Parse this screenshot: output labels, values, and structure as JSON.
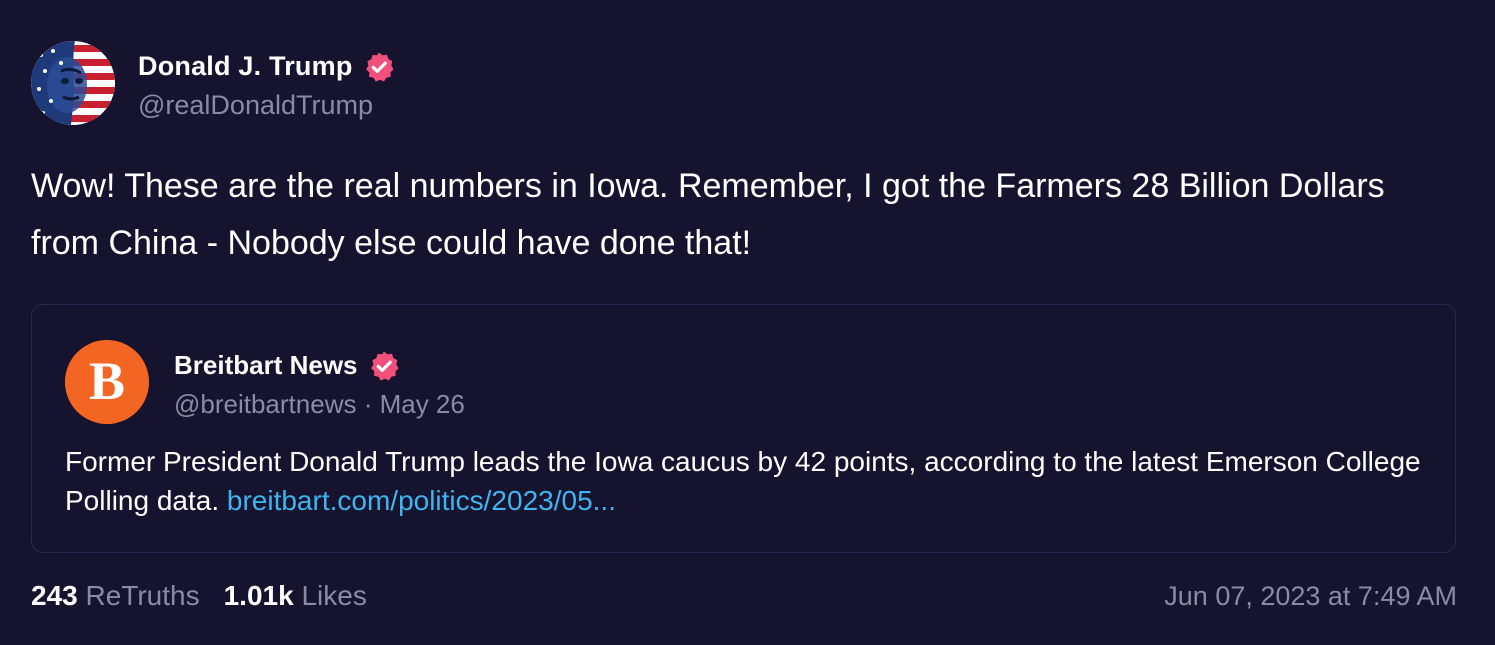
{
  "post": {
    "author": {
      "display_name": "Donald J. Trump",
      "handle": "@realDonaldTrump",
      "verified": true,
      "verified_icon": "verified-badge-icon"
    },
    "text": "Wow! These are the real numbers in Iowa. Remember, I got the Farmers 28 Billion Dollars from China - Nobody else could have done that!",
    "quote": {
      "author": {
        "display_name": "Breitbart News",
        "handle": "@breitbartnews",
        "separator": " · ",
        "date": "May 26",
        "verified": true,
        "avatar_letter": "B"
      },
      "text": "Former President Donald Trump leads the Iowa caucus by 42 points, according to the latest Emerson College Polling data. ",
      "link_text": "breitbart.com/politics/2023/05..."
    },
    "stats": {
      "retruths_count": "243",
      "retruths_label": "ReTruths",
      "likes_count": "1.01k",
      "likes_label": "Likes"
    },
    "timestamp": "Jun 07, 2023 at 7:49 AM"
  },
  "colors": {
    "background": "#16132f",
    "verified_badge": "#f0507b",
    "link": "#3fb4ee",
    "muted_text": "#8c8aa3",
    "breitbart_orange": "#f26522"
  }
}
